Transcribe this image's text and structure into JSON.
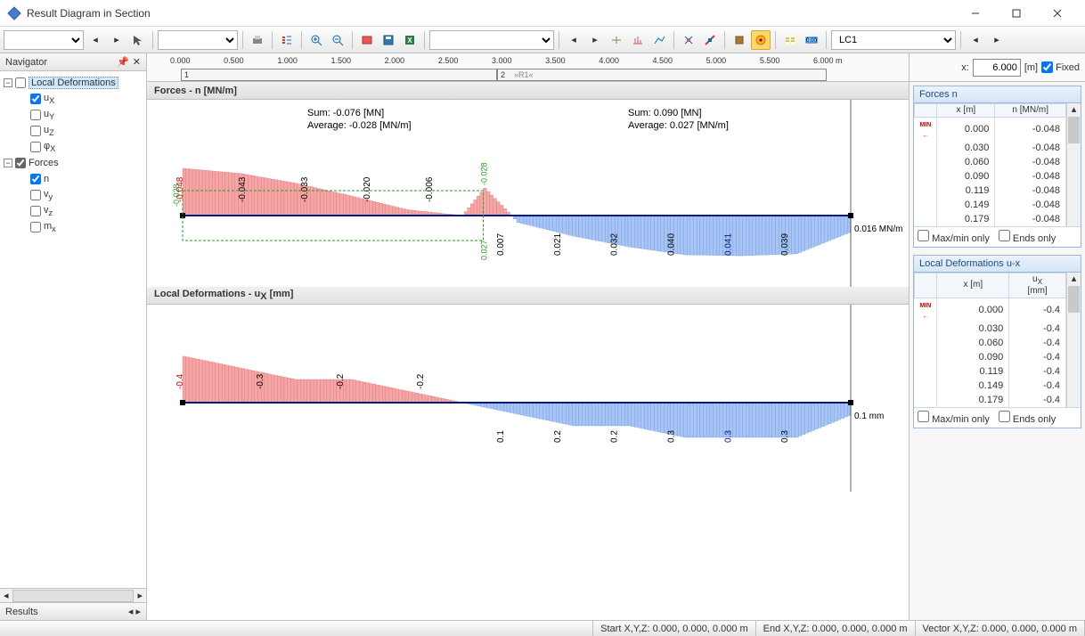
{
  "window": {
    "title": "Result Diagram in Section"
  },
  "toolbar": {
    "nav_prev": "◀",
    "nav_next": "▶",
    "lc_dropdown": "LC1"
  },
  "navigator": {
    "title": "Navigator",
    "groups": [
      {
        "label": "Local Deformations",
        "items": [
          {
            "label": "uX",
            "sub": "X",
            "checked": true
          },
          {
            "label": "uY",
            "sub": "Y",
            "checked": false
          },
          {
            "label": "uZ",
            "sub": "Z",
            "checked": false
          },
          {
            "label": "φX",
            "sub": "X",
            "checked": false
          }
        ]
      },
      {
        "label": "Forces",
        "items": [
          {
            "label": "n",
            "sub": "",
            "checked": true
          },
          {
            "label": "vy",
            "sub": "y",
            "checked": false
          },
          {
            "label": "vz",
            "sub": "z",
            "checked": false
          },
          {
            "label": "mx",
            "sub": "x",
            "checked": false
          }
        ]
      }
    ],
    "results_tab": "Results"
  },
  "ruler": {
    "ticks": [
      "0.000",
      "0.500",
      "1.000",
      "1.500",
      "2.000",
      "2.500",
      "3.000",
      "3.500",
      "4.000",
      "4.500",
      "5.000",
      "5.500",
      "6.000 m"
    ],
    "seg1": "1",
    "seg2a": "2",
    "seg2b": "»R1«",
    "x_label": "x:",
    "x_value": "6.000",
    "x_unit": "[m]",
    "fixed_label": "Fixed"
  },
  "charts": {
    "forces": {
      "title": "Forces - n [MN/m]",
      "sum_neg": "Sum: -0.076 [MN]",
      "avg_neg": "Average: -0.028 [MN/m]",
      "sum_pos": "Sum: 0.090 [MN]",
      "avg_pos": "Average: 0.027 [MN/m]",
      "end_label": "0.016 MN/m",
      "neg_labels": [
        "-0.048",
        "-0.043",
        "-0.033",
        "-0.020",
        "-0.006"
      ],
      "pos_labels": [
        "0.007",
        "0.021",
        "0.032",
        "0.040",
        "0.041",
        "0.039"
      ],
      "green_left": "-0.028",
      "green_top": "-0.028",
      "green_bot": "0.027"
    },
    "deform": {
      "title": "Local Deformations - uX [mm]",
      "end_label": "0.1 mm",
      "neg_labels": [
        "-0.4",
        "-0.3",
        "-0.2",
        "-0.2"
      ],
      "pos_labels": [
        "0.1",
        "0.2",
        "0.2",
        "0.3",
        "0.3",
        "0.3"
      ]
    }
  },
  "tables": {
    "forces": {
      "title": "Forces n",
      "col1": "x\n[m]",
      "col2": "n\n[MN/m]",
      "rows": [
        {
          "x": "0.000",
          "v": "-0.048",
          "min": true
        },
        {
          "x": "0.030",
          "v": "-0.048"
        },
        {
          "x": "0.060",
          "v": "-0.048"
        },
        {
          "x": "0.090",
          "v": "-0.048"
        },
        {
          "x": "0.119",
          "v": "-0.048"
        },
        {
          "x": "0.149",
          "v": "-0.048"
        },
        {
          "x": "0.179",
          "v": "-0.048"
        }
      ],
      "maxmin": "Max/min only",
      "ends": "Ends only"
    },
    "deform": {
      "title": "Local Deformations u-x",
      "col1": "x\n[m]",
      "col2": "uX\n[mm]",
      "rows": [
        {
          "x": "0.000",
          "v": "-0.4",
          "min": true
        },
        {
          "x": "0.030",
          "v": "-0.4"
        },
        {
          "x": "0.060",
          "v": "-0.4"
        },
        {
          "x": "0.090",
          "v": "-0.4"
        },
        {
          "x": "0.119",
          "v": "-0.4"
        },
        {
          "x": "0.149",
          "v": "-0.4"
        },
        {
          "x": "0.179",
          "v": "-0.4"
        }
      ],
      "maxmin": "Max/min only",
      "ends": "Ends only"
    }
  },
  "status": {
    "start": "Start X,Y,Z:   0.000, 0.000, 0.000 m",
    "end": "End X,Y,Z:   0.000, 0.000, 0.000 m",
    "vector": "Vector X,Y,Z:   0.000, 0.000, 0.000 m"
  },
  "chart_data": [
    {
      "type": "bar",
      "title": "Forces - n [MN/m]",
      "xlabel": "x [m]",
      "ylabel": "n [MN/m]",
      "x_range": [
        0,
        6.0
      ],
      "series": [
        {
          "name": "n",
          "x": [
            0,
            0.5,
            1.0,
            1.5,
            2.0,
            2.5,
            2.7,
            3.0,
            3.5,
            4.0,
            4.5,
            5.0,
            5.5,
            6.0
          ],
          "values": [
            -0.048,
            -0.043,
            -0.033,
            -0.02,
            -0.006,
            0.0,
            -0.028,
            0.007,
            0.021,
            0.032,
            0.04,
            0.041,
            0.039,
            0.016
          ]
        }
      ],
      "annotations": {
        "sum_neg": -0.076,
        "avg_neg": -0.028,
        "sum_pos": 0.09,
        "avg_pos": 0.027
      }
    },
    {
      "type": "bar",
      "title": "Local Deformations - uX [mm]",
      "xlabel": "x [m]",
      "ylabel": "uX [mm]",
      "x_range": [
        0,
        6.0
      ],
      "series": [
        {
          "name": "uX",
          "x": [
            0,
            0.5,
            1.0,
            1.5,
            2.0,
            2.5,
            3.0,
            3.5,
            4.0,
            4.5,
            5.0,
            5.5,
            6.0
          ],
          "values": [
            -0.4,
            -0.3,
            -0.2,
            -0.2,
            -0.1,
            0.0,
            0.1,
            0.2,
            0.2,
            0.3,
            0.3,
            0.3,
            0.1
          ]
        }
      ]
    }
  ]
}
